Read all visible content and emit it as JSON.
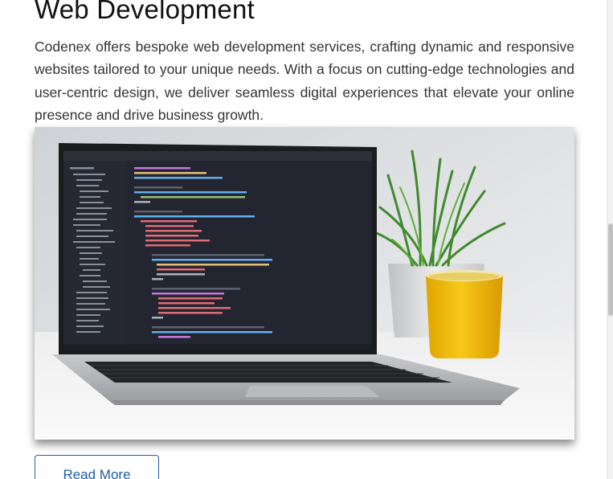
{
  "section": {
    "title": "Web Development",
    "description": "Codenex offers bespoke web development services, crafting dynamic and responsive websites tailored to your unique needs. With a focus on cutting-edge technologies and user-centric design, we deliver seamless digital experiences that elevate your online presence and drive business growth.",
    "image_alt": "Laptop showing code editor next to a yellow mug and a plant",
    "read_more_label": "Read More"
  },
  "colors": {
    "accent": "#1f5ea8",
    "text": "#333333",
    "heading": "#111111"
  }
}
